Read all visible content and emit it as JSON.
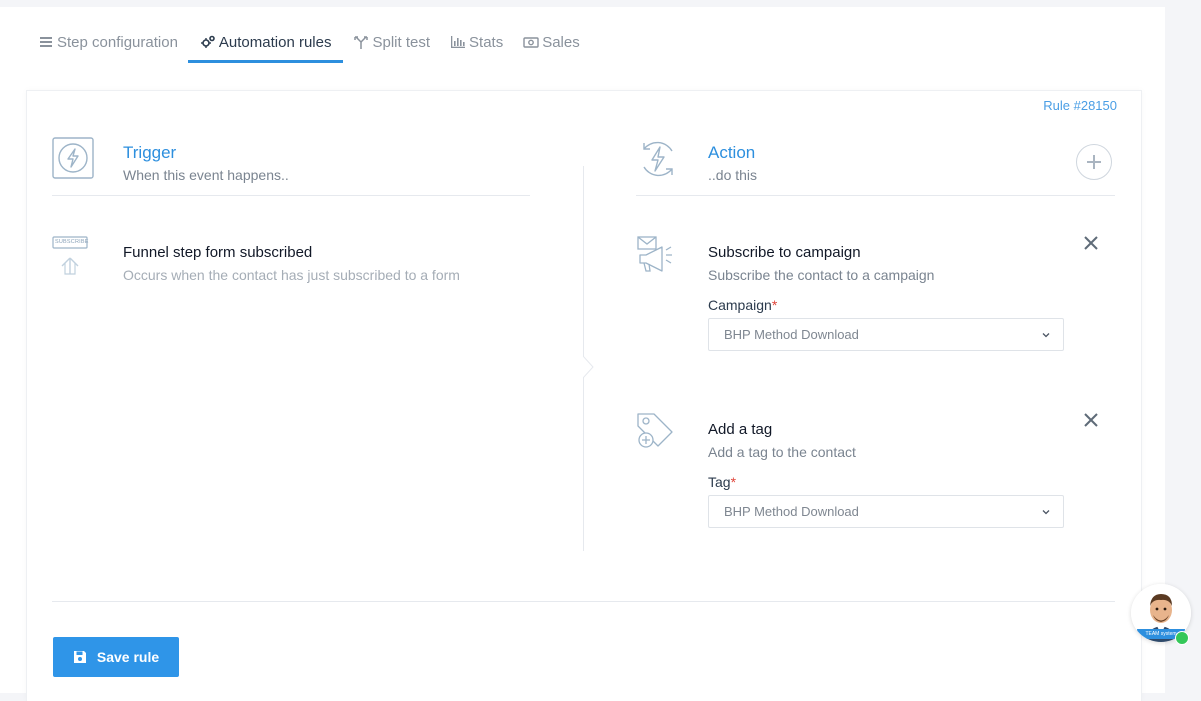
{
  "tabs": [
    {
      "label": "Step configuration",
      "icon": "list-icon"
    },
    {
      "label": "Automation rules",
      "icon": "gears-icon",
      "active": true
    },
    {
      "label": "Split test",
      "icon": "split-icon"
    },
    {
      "label": "Stats",
      "icon": "bar-chart-icon"
    },
    {
      "label": "Sales",
      "icon": "money-icon"
    }
  ],
  "rule": {
    "id_label": "Rule #28150"
  },
  "trigger": {
    "title": "Trigger",
    "subtitle": "When this event happens..",
    "event": {
      "title": "Funnel step form subscribed",
      "description": "Occurs when the contact has just subscribed to a form",
      "icon_text": "SUBSCRIBE"
    }
  },
  "action": {
    "title": "Action",
    "subtitle": "..do this",
    "items": [
      {
        "title": "Subscribe to campaign",
        "description": "Subscribe the contact to a campaign",
        "field_label": "Campaign",
        "required_mark": "*",
        "selected": "BHP Method Download"
      },
      {
        "title": "Add a tag",
        "description": "Add a tag to the contact",
        "field_label": "Tag",
        "required_mark": "*",
        "selected": "BHP Method Download"
      }
    ]
  },
  "footer": {
    "save_label": "Save rule"
  },
  "chat": {
    "badge_text": "TEAM system"
  },
  "colors": {
    "accent": "#2d8fde",
    "button": "#2f95e8",
    "required": "#e0453b",
    "online": "#34c759"
  }
}
